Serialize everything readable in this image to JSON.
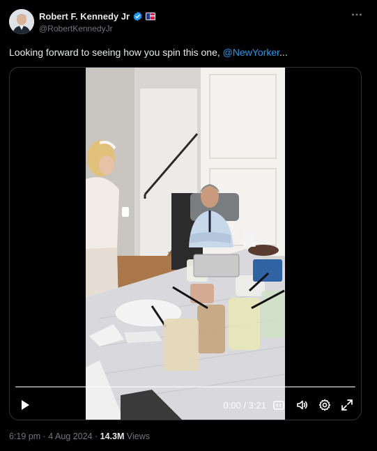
{
  "author": {
    "display_name": "Robert F. Kennedy Jr",
    "handle": "@RobertKennedyJr"
  },
  "tweet": {
    "text_before": "Looking forward to seeing how you spin this one, ",
    "mention": "@NewYorker",
    "text_after": "..."
  },
  "video": {
    "time_display": "0:00 / 3:21",
    "progress": 0
  },
  "meta": {
    "time": "6:19 pm",
    "separator": " · ",
    "date": "4 Aug 2024",
    "views_count": "14.3M",
    "views_label": "Views"
  },
  "colors": {
    "accent": "#1d9bf0",
    "background": "#000000",
    "text_primary": "#e7e9ea",
    "text_secondary": "#71767b"
  },
  "icons": [
    "verified-badge-icon",
    "flag-badge-icon",
    "more-icon",
    "play-icon",
    "captions-icon",
    "volume-icon",
    "settings-icon",
    "fullscreen-icon"
  ]
}
